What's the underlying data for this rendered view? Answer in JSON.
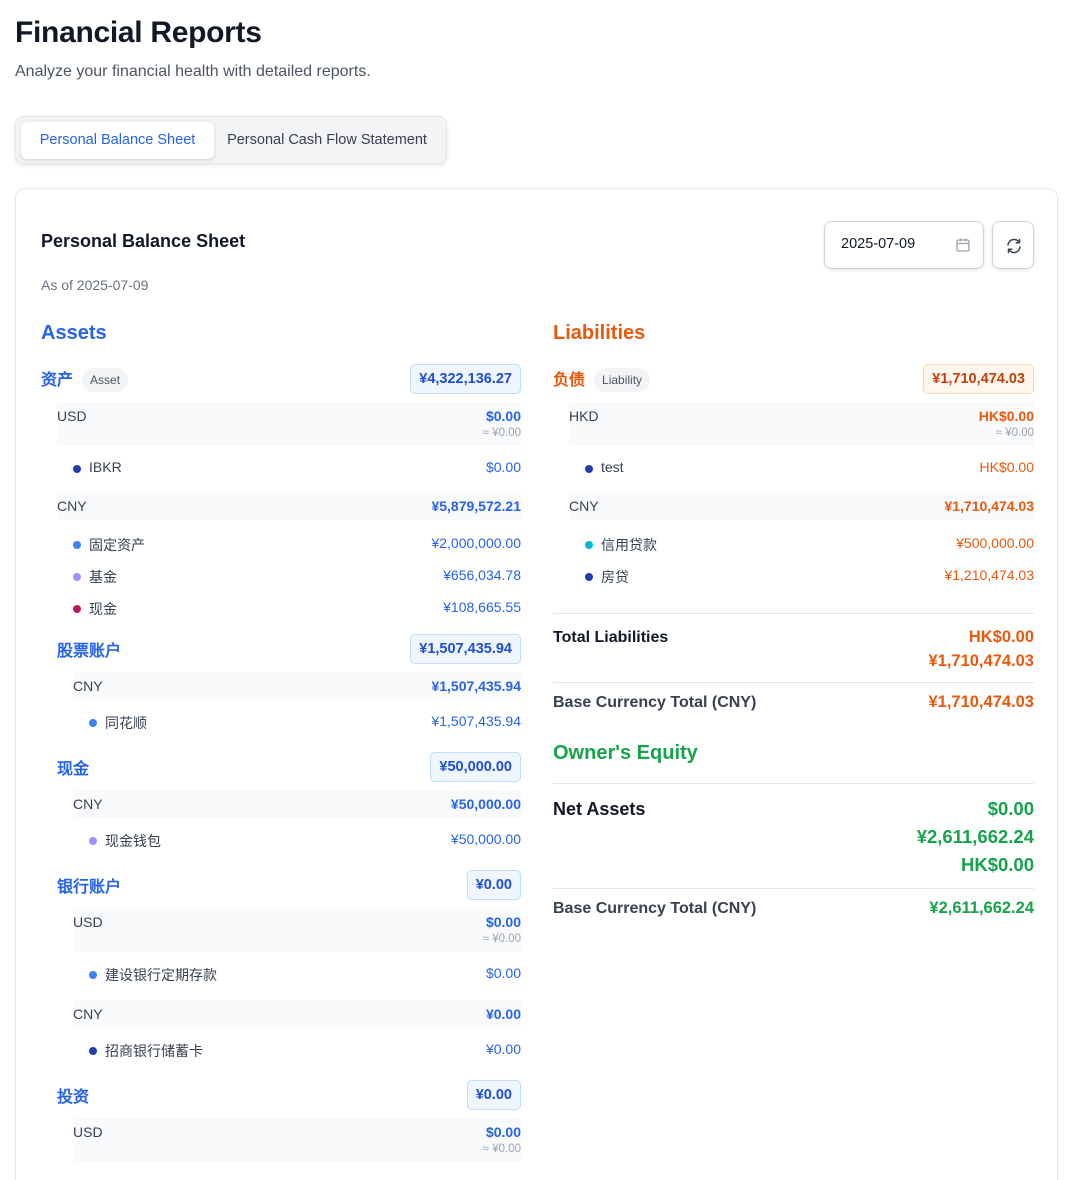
{
  "page": {
    "title": "Financial Reports",
    "subtitle": "Analyze your financial health with detailed reports."
  },
  "tabs": [
    {
      "label": "Personal Balance Sheet",
      "active": true
    },
    {
      "label": "Personal Cash Flow Statement",
      "active": false
    }
  ],
  "report": {
    "title": "Personal Balance Sheet",
    "as_of": "As of 2025-07-09",
    "date_value": "2025-07-09"
  },
  "colors": {
    "assets": "#2563eb",
    "liabilities": "#ea580c",
    "equity": "#16a34a"
  },
  "assets": {
    "title": "Assets",
    "categories": [
      {
        "name": "资产",
        "type_badge": "Asset",
        "total": "¥4,322,136.27",
        "currencies": [
          {
            "code": "USD",
            "amount": "$0.00",
            "approx": "≈ ¥0.00",
            "accounts": [
              {
                "name": "IBKR",
                "amount": "$0.00",
                "dot_color": "#1e40af"
              }
            ]
          },
          {
            "code": "CNY",
            "amount": "¥5,879,572.21",
            "accounts": [
              {
                "name": "固定资产",
                "amount": "¥2,000,000.00",
                "dot_color": "#3b82f6"
              },
              {
                "name": "基金",
                "amount": "¥656,034.78",
                "dot_color": "#a78bfa"
              },
              {
                "name": "现金",
                "amount": "¥108,665.55",
                "dot_color": "#be185d"
              }
            ]
          }
        ]
      },
      {
        "name": "股票账户",
        "total": "¥1,507,435.94",
        "currencies": [
          {
            "code": "CNY",
            "amount": "¥1,507,435.94",
            "accounts": [
              {
                "name": "同花顺",
                "amount": "¥1,507,435.94",
                "dot_color": "#3b82f6"
              }
            ]
          }
        ]
      },
      {
        "name": "现金",
        "total": "¥50,000.00",
        "currencies": [
          {
            "code": "CNY",
            "amount": "¥50,000.00",
            "accounts": [
              {
                "name": "现金钱包",
                "amount": "¥50,000.00",
                "dot_color": "#a78bfa"
              }
            ]
          }
        ]
      },
      {
        "name": "银行账户",
        "total": "¥0.00",
        "currencies": [
          {
            "code": "USD",
            "amount": "$0.00",
            "approx": "≈ ¥0.00",
            "accounts": [
              {
                "name": "建设银行定期存款",
                "amount": "$0.00",
                "dot_color": "#3b82f6"
              }
            ]
          },
          {
            "code": "CNY",
            "amount": "¥0.00",
            "accounts": [
              {
                "name": "招商银行储蓄卡",
                "amount": "¥0.00",
                "dot_color": "#1e40af"
              }
            ]
          }
        ]
      },
      {
        "name": "投资",
        "total": "¥0.00",
        "currencies": [
          {
            "code": "USD",
            "amount": "$0.00",
            "approx": "≈ ¥0.00",
            "accounts": []
          }
        ]
      }
    ]
  },
  "liabilities": {
    "title": "Liabilities",
    "category": {
      "name": "负债",
      "type_badge": "Liability",
      "total": "¥1,710,474.03",
      "currencies": [
        {
          "code": "HKD",
          "amount": "HK$0.00",
          "approx": "≈ ¥0.00",
          "accounts": [
            {
              "name": "test",
              "amount": "HK$0.00",
              "dot_color": "#1e40af"
            }
          ]
        },
        {
          "code": "CNY",
          "amount": "¥1,710,474.03",
          "accounts": [
            {
              "name": "信用贷款",
              "amount": "¥500,000.00",
              "dot_color": "#06b6d4"
            },
            {
              "name": "房贷",
              "amount": "¥1,210,474.03",
              "dot_color": "#1e40af"
            }
          ]
        }
      ]
    },
    "total_label": "Total Liabilities",
    "totals": [
      "HK$0.00",
      "¥1,710,474.03"
    ],
    "base_label": "Base Currency Total (CNY)",
    "base_total": "¥1,710,474.03"
  },
  "equity": {
    "title": "Owner's Equity",
    "net_label": "Net Assets",
    "net_values": [
      "$0.00",
      "¥2,611,662.24",
      "HK$0.00"
    ],
    "base_label": "Base Currency Total (CNY)",
    "base_total": "¥2,611,662.24"
  }
}
